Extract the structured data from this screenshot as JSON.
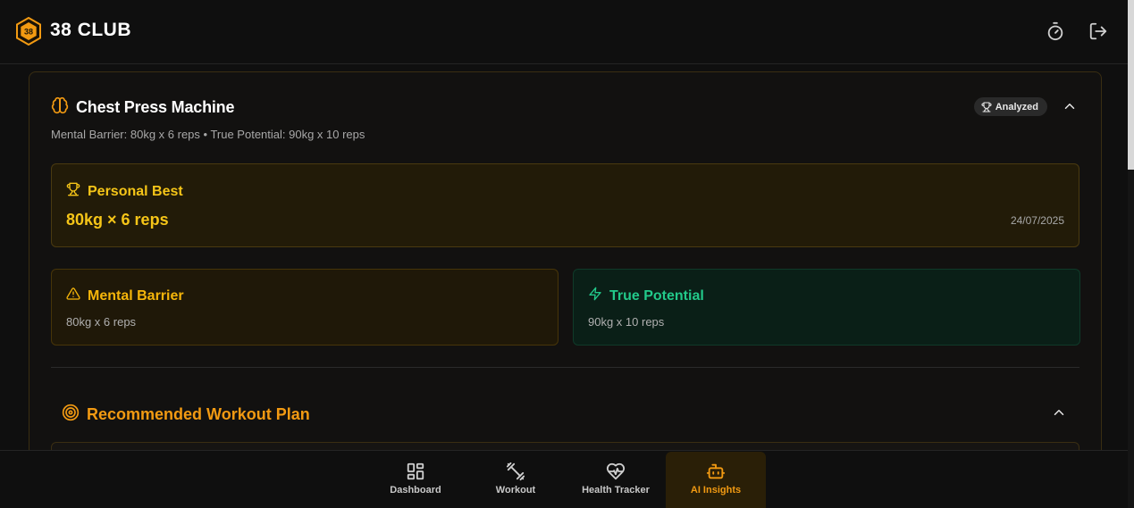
{
  "header": {
    "app_name": "38 CLUB",
    "logo_text": "38",
    "icons": [
      "timer-icon",
      "logout-icon"
    ]
  },
  "card": {
    "title": "Chest Press Machine",
    "subtitle": "Mental Barrier: 80kg x 6 reps • True Potential: 90kg x 10 reps",
    "badge": "Analyzed",
    "personal_best": {
      "label": "Personal Best",
      "value": "80kg × 6 reps",
      "date": "24/07/2025"
    },
    "mental_barrier": {
      "label": "Mental Barrier",
      "value": "80kg x 6 reps"
    },
    "true_potential": {
      "label": "True Potential",
      "value": "90kg x 10 reps"
    },
    "plan": {
      "title": "Recommended Workout Plan"
    }
  },
  "nav": {
    "items": [
      {
        "label": "Dashboard",
        "icon": "grid-icon"
      },
      {
        "label": "Workout",
        "icon": "dumbbell-icon"
      },
      {
        "label": "Health Tracker",
        "icon": "heart-pulse-icon"
      },
      {
        "label": "AI Insights",
        "icon": "robot-icon",
        "active": true
      }
    ]
  },
  "colors": {
    "accent_orange": "#f29a12",
    "gold": "#f5c518",
    "green": "#22c98a",
    "background": "#0f0f0f"
  }
}
